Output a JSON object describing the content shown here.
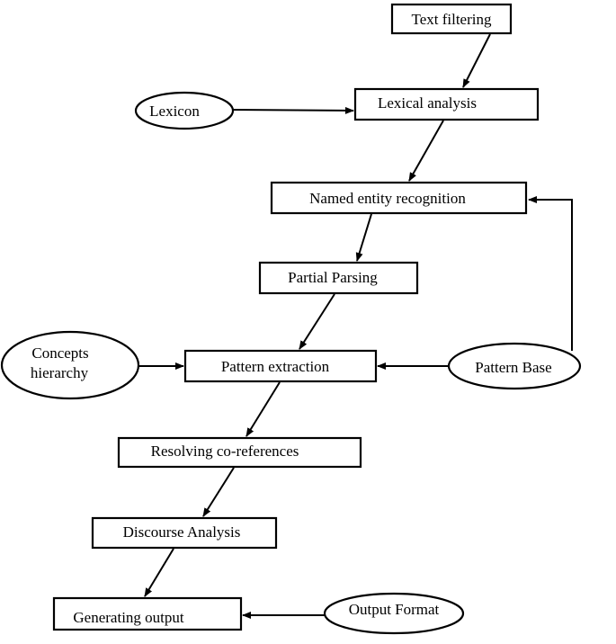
{
  "diagram": {
    "processes": {
      "text_filtering": "Text filtering",
      "lexical_analysis": "Lexical analysis",
      "named_entity_recognition": "Named entity recognition",
      "partial_parsing": "Partial Parsing",
      "pattern_extraction": "Pattern extraction",
      "resolving_coreferences": "Resolving co-references",
      "discourse_analysis": "Discourse Analysis",
      "generating_output": "Generating output"
    },
    "resources": {
      "lexicon": "Lexicon",
      "concepts_hierarchy_line1": "Concepts",
      "concepts_hierarchy_line2": "hierarchy",
      "pattern_base": "Pattern Base",
      "output_format": "Output Format"
    },
    "edges": [
      [
        "Text filtering",
        "Lexical analysis"
      ],
      [
        "Lexicon",
        "Lexical analysis"
      ],
      [
        "Lexical analysis",
        "Named entity recognition"
      ],
      [
        "Named entity recognition",
        "Partial Parsing"
      ],
      [
        "Partial Parsing",
        "Pattern extraction"
      ],
      [
        "Concepts hierarchy",
        "Pattern extraction"
      ],
      [
        "Pattern Base",
        "Pattern extraction"
      ],
      [
        "Pattern Base",
        "Named entity recognition"
      ],
      [
        "Pattern extraction",
        "Resolving co-references"
      ],
      [
        "Resolving co-references",
        "Discourse Analysis"
      ],
      [
        "Discourse Analysis",
        "Generating output"
      ],
      [
        "Output Format",
        "Generating output"
      ]
    ]
  }
}
